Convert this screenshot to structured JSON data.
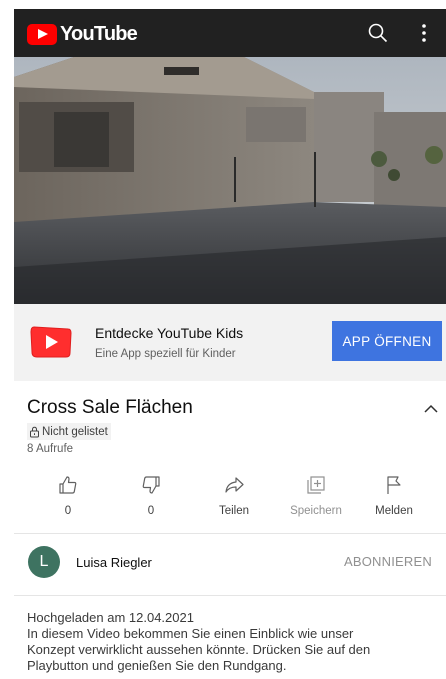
{
  "header": {
    "logo_text": "YouTube",
    "icons": [
      "search-icon",
      "more-vert-icon"
    ]
  },
  "colors": {
    "header_bg": "#212121",
    "brand_red": "#ff0000",
    "banner_bg": "#f2f2f2",
    "app_button": "#3e74e0",
    "avatar_bg": "#3e7361"
  },
  "kids_banner": {
    "title": "Entdecke YouTube Kids",
    "subtitle": "Eine App speziell für Kinder",
    "button_label": "APP ÖFFNEN"
  },
  "video": {
    "title": "Cross Sale Flächen",
    "visibility": "Nicht gelistet",
    "views": "8 Aufrufe"
  },
  "actions": [
    {
      "label": "0",
      "icon": "thumb-up-icon"
    },
    {
      "label": "0",
      "icon": "thumb-down-icon"
    },
    {
      "label": "Teilen",
      "icon": "share-icon"
    },
    {
      "label": "Speichern",
      "icon": "add-to-playlist-icon"
    },
    {
      "label": "Melden",
      "icon": "flag-icon"
    }
  ],
  "channel": {
    "avatar_letter": "L",
    "name": "Luisa Riegler",
    "subscribe_label": "ABONNIEREN"
  },
  "description": {
    "uploaded": "Hochgeladen am 12.04.2021",
    "lines": [
      "In diesem Video bekommen Sie einen Einblick wie unser",
      "Konzept verwirklicht aussehen könnte. Drücken Sie auf den",
      "Playbutton und genießen Sie den Rundgang."
    ]
  }
}
